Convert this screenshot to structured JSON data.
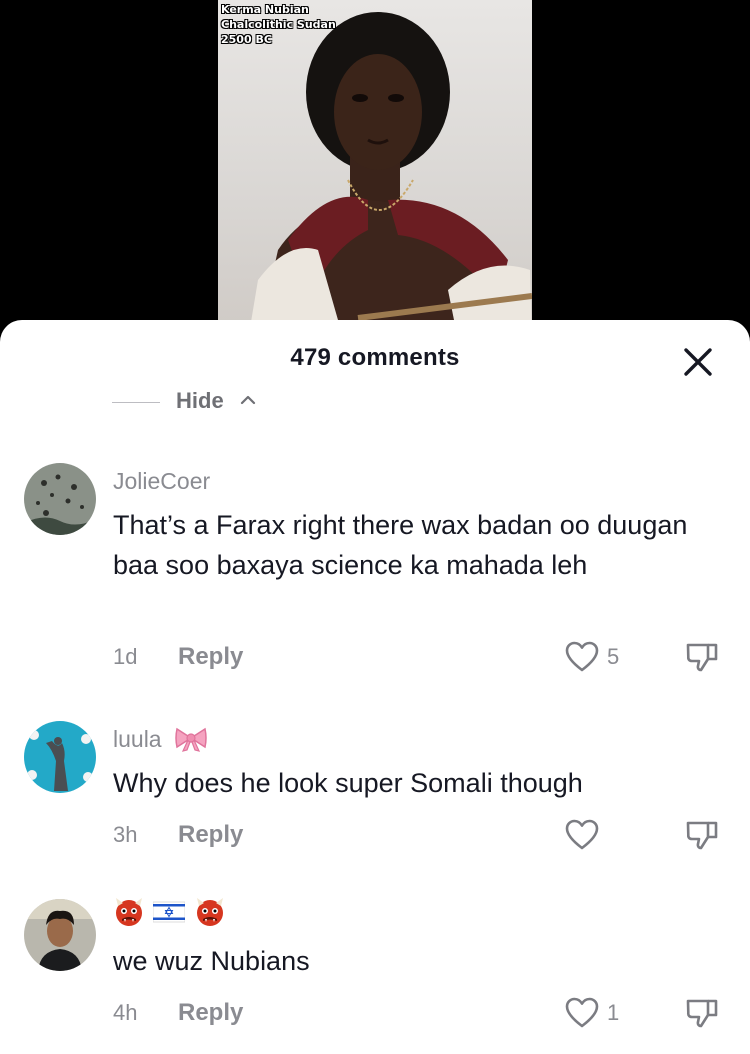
{
  "video": {
    "overlay_lines": [
      "Kerma Nubian",
      "Chalcolithic Sudan",
      "2500 BC"
    ]
  },
  "sheet": {
    "title": "479 comments",
    "hide_label": "Hide"
  },
  "comments": [
    {
      "username": "JolieCoer",
      "text": "That’s a Farax right there wax badan oo duugan baa soo baxaya science ka mahada leh",
      "time": "1d",
      "reply_label": "Reply",
      "likes": "5"
    },
    {
      "username": "luula",
      "username_emoji": "bow-emoji",
      "text": "Why does he look super Somali though",
      "time": "3h",
      "reply_label": "Reply",
      "likes": ""
    },
    {
      "username_emojis": [
        "ogre-emoji",
        "israel-flag-emoji",
        "ogre-emoji"
      ],
      "text": "we wuz Nubians",
      "time": "4h",
      "reply_label": "Reply",
      "likes": "1"
    }
  ],
  "icons": [
    "close-icon",
    "chevron-up-icon",
    "heart-icon",
    "dislike-icon"
  ],
  "colors": {
    "text_primary": "#161823",
    "text_secondary": "#8a8b91",
    "sheet_bg": "#ffffff",
    "video_bg": "#000000"
  }
}
